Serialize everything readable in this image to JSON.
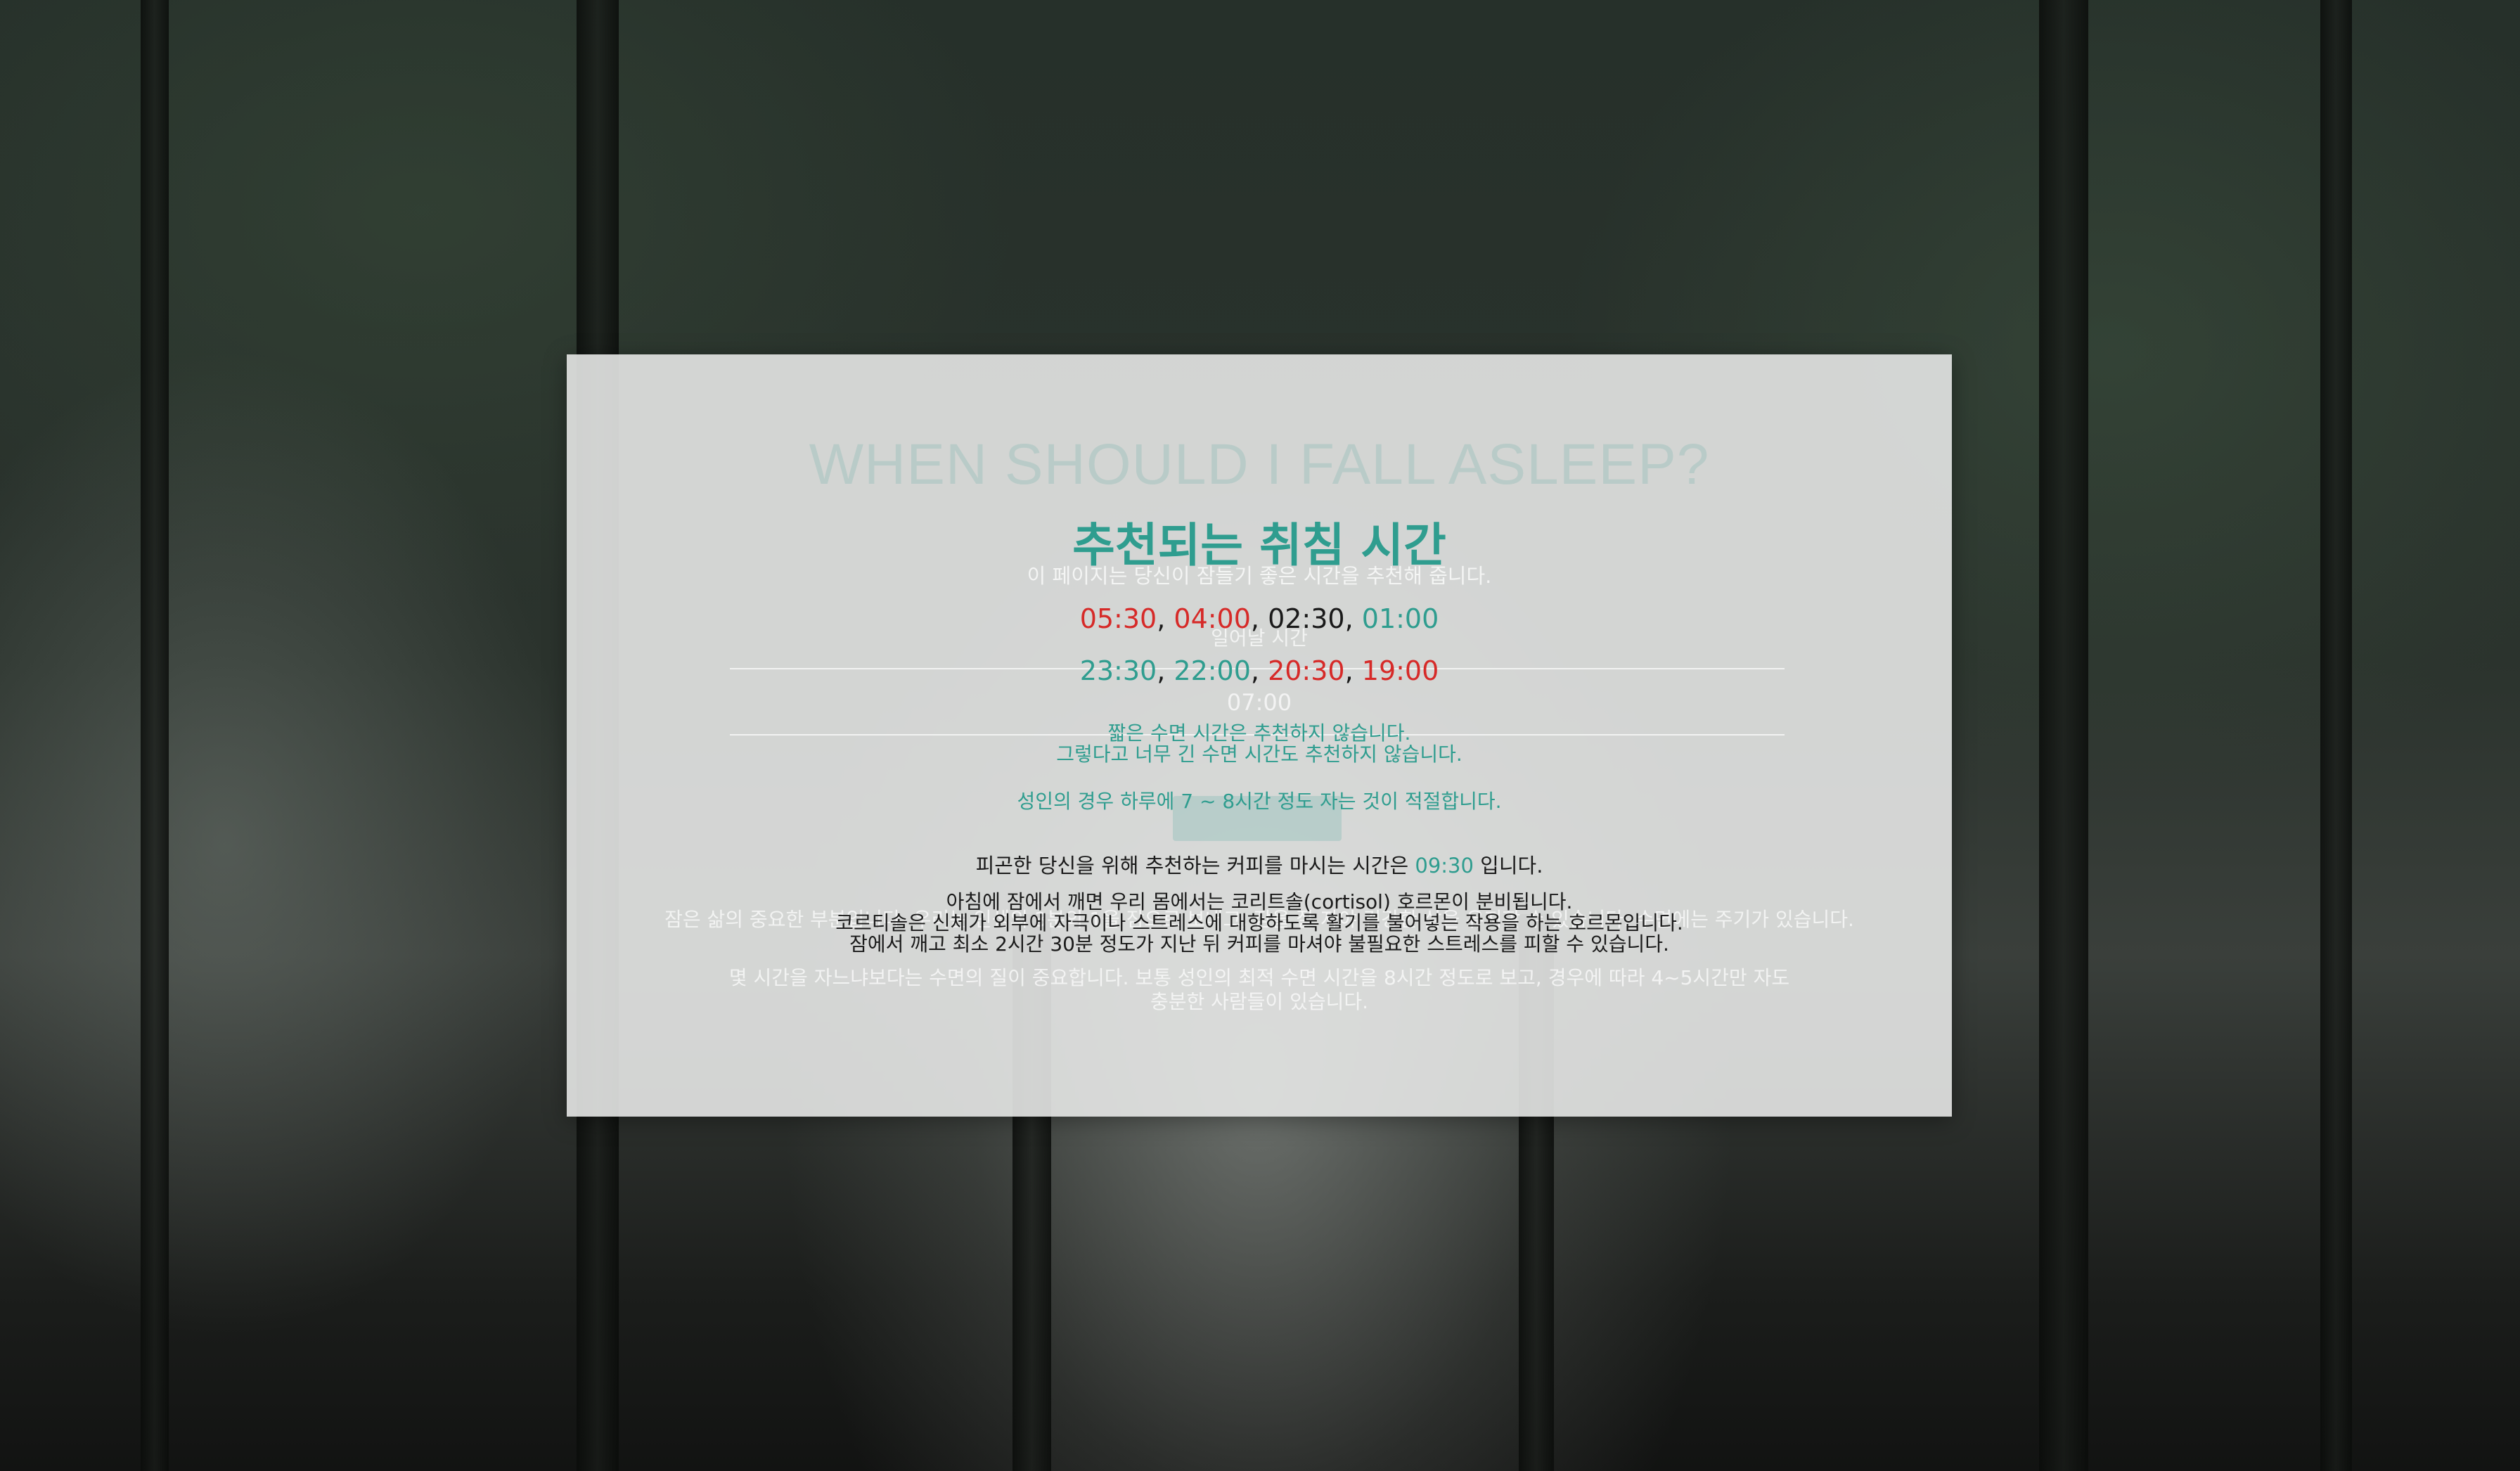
{
  "background": {
    "description_icon": "forest-background"
  },
  "ghost_layer": {
    "title": "WHEN SHOULD I FALL ASLEEP?",
    "description": "이 페이지는 당신이 잠들기 좋은 시간을 추천해 줍니다.",
    "label": "일어날 시간",
    "wake_value": "07:00",
    "para1": "잠은 삶의 중요한 부분입니다. 우리는 인생의 3분의 1을 잠으로 보내고, 잠을 잘 자야 건강한 삶을 유지할 수 있습니다. 수면에는 주기가 있습니다.",
    "para2_line1": "몇 시간을 자느냐보다는 수면의 질이 중요합니다. 보통 성인의 최적 수면 시간을 8시간 정도로 보고, 경우에 따라 4~5시간만 자도",
    "para2_line2": "충분한 사람들이 있습니다."
  },
  "result": {
    "title": "추천되는 취침 시간",
    "times_row1": [
      {
        "value": "05:30",
        "color": "red"
      },
      {
        "value": "04:00",
        "color": "red"
      },
      {
        "value": "02:30",
        "color": "dark"
      },
      {
        "value": "01:00",
        "color": "teal"
      }
    ],
    "times_row2": [
      {
        "value": "23:30",
        "color": "teal"
      },
      {
        "value": "22:00",
        "color": "teal"
      },
      {
        "value": "20:30",
        "color": "red"
      },
      {
        "value": "19:00",
        "color": "red"
      }
    ],
    "separator": ", ",
    "note_line1": "짧은 수면 시간은 추천하지 않습니다.",
    "note_line2": "그렇다고 너무 긴 수면 시간도 추천하지 않습니다.",
    "adult_note": "성인의 경우 하루에 7 ~ 8시간 정도 자는 것이 적절합니다.",
    "coffee_prefix": "피곤한 당신을 위해 추천하는 커피를 마시는 시간은 ",
    "coffee_time": "09:30",
    "coffee_suffix": " 입니다.",
    "cortisol_line1": "아침에 잠에서 깨면 우리 몸에서는 코리트솔(cortisol) 호르몬이 분비됩니다.",
    "cortisol_line2": "코르티솔은 신체가 외부에 자극이나 스트레스에 대항하도록 활기를 불어넣는 작용을 하는 호르몬입니다.",
    "cortisol_line3": "잠에서 깨고 최소 2시간 30분 정도가 지난 뒤 커피를 마셔야 불필요한 스트레스를 피할 수 있습니다."
  },
  "colors": {
    "teal": "#2f9d8f",
    "red": "#d62a28",
    "dark": "#1a1a1a",
    "card": "#e5e7e6"
  }
}
